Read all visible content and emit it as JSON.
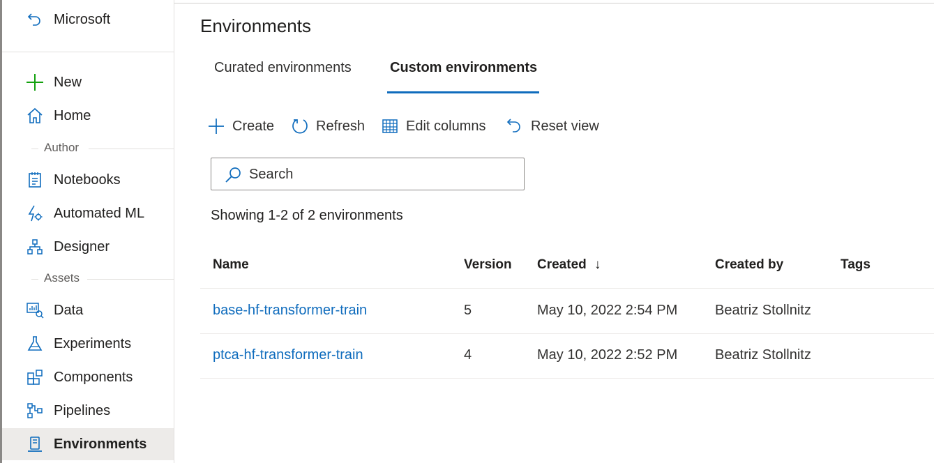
{
  "sidebar": {
    "back_label": "Microsoft",
    "new_label": "New",
    "home_label": "Home",
    "author_section": "Author",
    "assets_section": "Assets",
    "items": [
      {
        "label": "Notebooks",
        "icon": "notebook-icon"
      },
      {
        "label": "Automated ML",
        "icon": "automated-ml-icon"
      },
      {
        "label": "Designer",
        "icon": "designer-icon"
      },
      {
        "label": "Data",
        "icon": "data-icon"
      },
      {
        "label": "Experiments",
        "icon": "flask-icon"
      },
      {
        "label": "Components",
        "icon": "components-icon"
      },
      {
        "label": "Pipelines",
        "icon": "pipelines-icon"
      },
      {
        "label": "Environments",
        "icon": "environments-icon"
      }
    ]
  },
  "main": {
    "title": "Environments",
    "tabs": [
      {
        "label": "Curated environments",
        "active": false
      },
      {
        "label": "Custom environments",
        "active": true
      }
    ],
    "toolbar": {
      "create": "Create",
      "refresh": "Refresh",
      "edit_columns": "Edit columns",
      "reset_view": "Reset view"
    },
    "search": {
      "placeholder": "Search",
      "value": ""
    },
    "count_text": "Showing 1-2 of 2 environments",
    "table": {
      "columns": [
        "Name",
        "Version",
        "Created",
        "Created by",
        "Tags"
      ],
      "sort_indicator": "↓",
      "rows": [
        {
          "name": "base-hf-transformer-train",
          "version": "5",
          "created": "May 10, 2022 2:54 PM",
          "created_by": "Beatriz Stollnitz",
          "tags": ""
        },
        {
          "name": "ptca-hf-transformer-train",
          "version": "4",
          "created": "May 10, 2022 2:52 PM",
          "created_by": "Beatriz Stollnitz",
          "tags": ""
        }
      ]
    }
  },
  "colors": {
    "accent": "#0f6cbd",
    "new_icon": "#13a10e",
    "active_nav_bg": "#edebe9"
  }
}
